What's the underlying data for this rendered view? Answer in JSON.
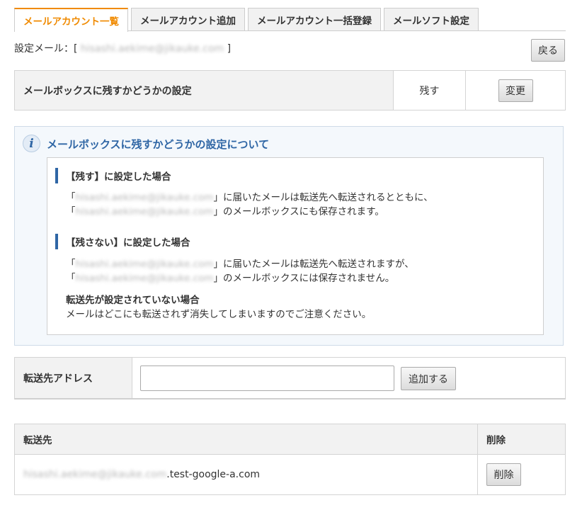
{
  "tabs": [
    {
      "label": "メールアカウント一覧",
      "active": true
    },
    {
      "label": "メールアカウント追加",
      "active": false
    },
    {
      "label": "メールアカウント一括登録",
      "active": false
    },
    {
      "label": "メールソフト設定",
      "active": false
    }
  ],
  "setting_mail": {
    "prefix": "設定メール：[",
    "address": "hisashi.aekime@jikauke.com",
    "suffix": "]"
  },
  "back_label": "戻る",
  "mailbox_setting": {
    "label": "メールボックスに残すかどうかの設定",
    "value": "残す",
    "change_label": "変更"
  },
  "info": {
    "title": "メールボックスに残すかどうかの設定について",
    "keep": {
      "title": "【残す】に設定した場合",
      "line1_open": "「",
      "line1_address": "hisashi.aekime@jikauke.com",
      "line1_text": "」に届いたメールは転送先へ転送されるとともに、",
      "line2_open": "「",
      "line2_address": "hisashi.aekime@jikauke.com",
      "line2_text": "」のメールボックスにも保存されます。"
    },
    "not_keep": {
      "title": "【残さない】に設定した場合",
      "line1_open": "「",
      "line1_address": "hisashi.aekime@jikauke.com",
      "line1_text": "」に届いたメールは転送先へ転送されますが、",
      "line2_open": "「",
      "line2_address": "hisashi.aekime@jikauke.com",
      "line2_text": "」のメールボックスには保存されません。"
    },
    "no_forward": {
      "title": "転送先が設定されていない場合",
      "text": "メールはどこにも転送されず消失してしまいますのでご注意ください。"
    }
  },
  "forward_form": {
    "label": "転送先アドレス",
    "input_value": "",
    "add_label": "追加する"
  },
  "forward_table": {
    "col_address": "転送先",
    "col_delete": "削除",
    "rows": [
      {
        "address_blurred": "hisashi.aekime@jikauke.com",
        "address_suffix": ".test-google-a.com",
        "delete_label": "削除"
      }
    ]
  }
}
